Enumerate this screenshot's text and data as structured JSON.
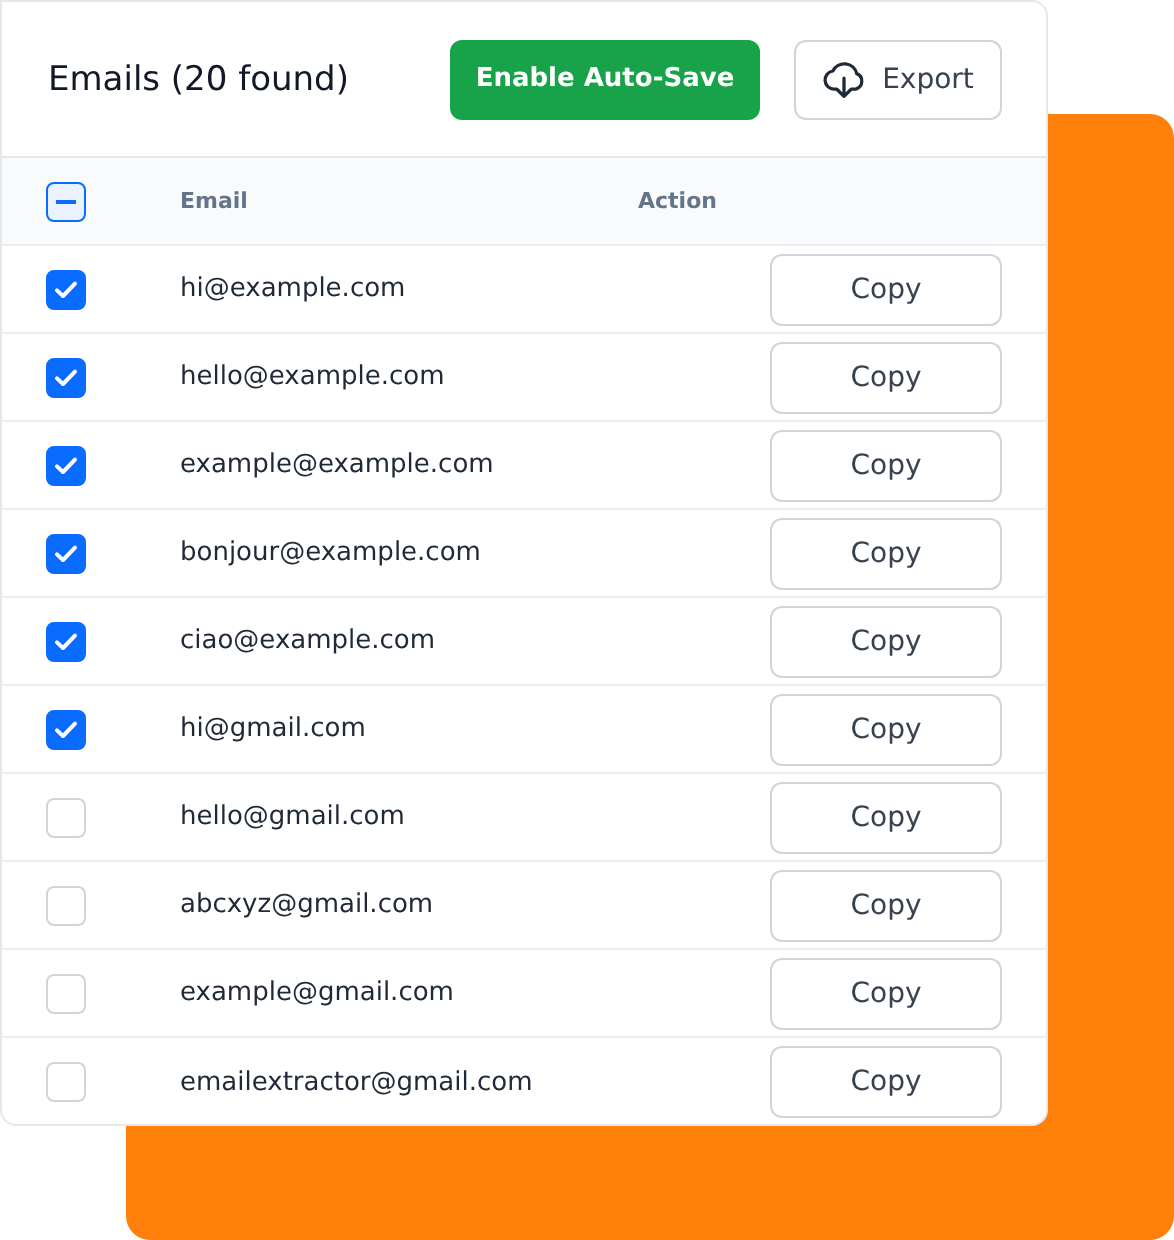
{
  "title": "Emails (20 found)",
  "buttons": [
    {
      "kind": "primary",
      "label": "Enable Auto-Save"
    },
    {
      "kind": "export",
      "label": "Export"
    }
  ],
  "table": {
    "select_all": {
      "indeterminate": true
    },
    "columns": [
      "Email",
      "Action"
    ],
    "rows": [
      {
        "checked": true,
        "email": "hi@example.com",
        "action": "Copy"
      },
      {
        "checked": true,
        "email": "hello@example.com",
        "action": "Copy"
      },
      {
        "checked": true,
        "email": "example@example.com",
        "action": "Copy"
      },
      {
        "checked": true,
        "email": "bonjour@example.com",
        "action": "Copy"
      },
      {
        "checked": true,
        "email": "ciao@example.com",
        "action": "Copy"
      },
      {
        "checked": true,
        "email": "hi@gmail.com",
        "action": "Copy"
      },
      {
        "checked": false,
        "email": "hello@gmail.com",
        "action": "Copy"
      },
      {
        "checked": false,
        "email": "abcxyz@gmail.com",
        "action": "Copy"
      },
      {
        "checked": false,
        "email": "example@gmail.com",
        "action": "Copy"
      },
      {
        "checked": false,
        "email": "emailextractor@gmail.com",
        "action": "Copy"
      }
    ]
  }
}
